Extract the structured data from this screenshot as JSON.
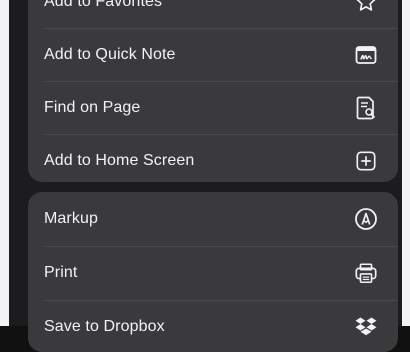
{
  "menu": {
    "group1": [
      {
        "label": "Add to Favorites",
        "icon": "star-icon"
      },
      {
        "label": "Add to Quick Note",
        "icon": "quick-note-icon"
      },
      {
        "label": "Find on Page",
        "icon": "find-on-page-icon"
      },
      {
        "label": "Add to Home Screen",
        "icon": "add-square-icon"
      }
    ],
    "group2": [
      {
        "label": "Markup",
        "icon": "markup-pen-icon"
      },
      {
        "label": "Print",
        "icon": "printer-icon"
      },
      {
        "label": "Save to Dropbox",
        "icon": "dropbox-icon"
      }
    ]
  },
  "colors": {
    "background": "#1c1c1e",
    "row_fill": "#3a3a3c",
    "text": "#f2f2f4"
  }
}
